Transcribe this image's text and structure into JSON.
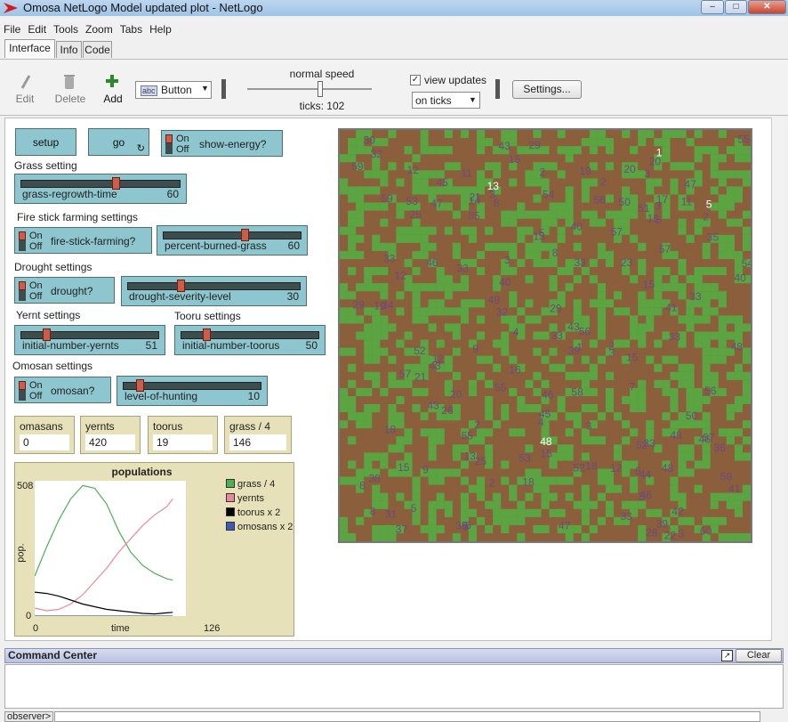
{
  "window": {
    "title": "Omosa NetLogo Model updated plot - NetLogo"
  },
  "menu": [
    "File",
    "Edit",
    "Tools",
    "Zoom",
    "Tabs",
    "Help"
  ],
  "tabs": [
    "Interface",
    "Info",
    "Code"
  ],
  "toolbar": {
    "edit": "Edit",
    "delete": "Delete",
    "add": "Add",
    "widget_type": "Button",
    "speed_label": "normal speed",
    "ticks_label": "ticks: 102",
    "view_updates": "view updates",
    "update_mode": "on ticks",
    "settings": "Settings..."
  },
  "buttons": {
    "setup": "setup",
    "go": "go"
  },
  "notes": {
    "grass": "Grass setting",
    "fire": "Fire stick farming settings",
    "drought": "Drought settings",
    "yernt": "Yernt settings",
    "tooru": "Tooru settings",
    "omosan": "Omosan settings"
  },
  "switches": {
    "on": "On",
    "off": "Off",
    "show_energy": "show-energy?",
    "fire_stick": "fire-stick-farming?",
    "drought": "drought?",
    "omosan": "omosan?"
  },
  "sliders": {
    "grass_regrowth": {
      "name": "grass-regrowth-time",
      "value": "60",
      "level": 0.6
    },
    "percent_burned": {
      "name": "percent-burned-grass",
      "value": "60",
      "level": 0.6
    },
    "drought_severity": {
      "name": "drought-severity-level",
      "value": "30",
      "level": 0.3
    },
    "init_yernts": {
      "name": "initial-number-yernts",
      "value": "51",
      "level": 0.17
    },
    "init_toorus": {
      "name": "initial-number-toorus",
      "value": "50",
      "level": 0.17
    },
    "hunting": {
      "name": "level-of-hunting",
      "value": "10",
      "level": 0.1
    }
  },
  "monitors": [
    {
      "label": "omasans",
      "value": "0"
    },
    {
      "label": "yernts",
      "value": "420"
    },
    {
      "label": "toorus",
      "value": "19"
    },
    {
      "label": "grass / 4",
      "value": "146"
    }
  ],
  "plot": {
    "title": "populations",
    "ylabel": "pop.",
    "xlabel": "time",
    "ymax": "508",
    "ymin": "0",
    "xmin": "0",
    "xmax": "126",
    "legend": [
      {
        "name": "grass / 4",
        "color": "#4caf50"
      },
      {
        "name": "yernts",
        "color": "#e8899a"
      },
      {
        "name": "toorus x 2",
        "color": "#000000"
      },
      {
        "name": "omosans x 2",
        "color": "#3b5bb5"
      }
    ]
  },
  "chart_data": {
    "type": "line",
    "title": "populations",
    "xlabel": "time",
    "ylabel": "pop.",
    "xlim": [
      0,
      126
    ],
    "ylim": [
      0,
      508
    ],
    "legend": "right",
    "series": [
      {
        "name": "grass / 4",
        "color": "#4caf50",
        "x": [
          0,
          10,
          20,
          30,
          40,
          50,
          60,
          70,
          80,
          90,
          100,
          110,
          115
        ],
        "y": [
          150,
          260,
          360,
          440,
          490,
          480,
          420,
          320,
          240,
          190,
          160,
          140,
          135
        ]
      },
      {
        "name": "yernts",
        "color": "#e8899a",
        "x": [
          0,
          10,
          20,
          30,
          40,
          50,
          60,
          70,
          80,
          90,
          100,
          110,
          115
        ],
        "y": [
          30,
          20,
          25,
          45,
          80,
          130,
          180,
          240,
          290,
          340,
          380,
          410,
          440
        ]
      },
      {
        "name": "toorus x 2",
        "color": "#000000",
        "x": [
          0,
          10,
          20,
          30,
          40,
          50,
          60,
          70,
          80,
          90,
          100,
          110,
          115
        ],
        "y": [
          90,
          85,
          75,
          60,
          45,
          35,
          25,
          20,
          15,
          10,
          8,
          12,
          14
        ]
      },
      {
        "name": "omosans x 2",
        "color": "#3b5bb5",
        "x": [
          0,
          115
        ],
        "y": [
          0,
          0
        ]
      }
    ]
  },
  "command_center": {
    "title": "Command Center",
    "clear": "Clear",
    "prompt": "observer>"
  }
}
